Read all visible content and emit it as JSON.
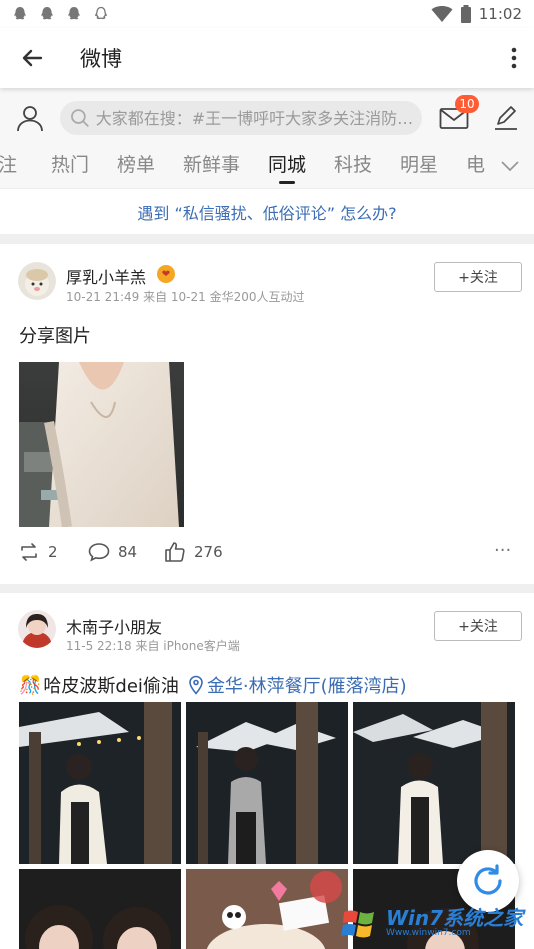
{
  "status_bar": {
    "time": "11:02",
    "icons": [
      "qq-icon",
      "qq-icon",
      "qq-icon",
      "qq-outline-icon",
      "wifi-icon",
      "battery-icon"
    ]
  },
  "app_bar": {
    "title": "微博"
  },
  "search": {
    "placeholder": "大家都在搜：#王一博呼吁大家多关注消防…",
    "mail_badge": "10"
  },
  "tabs": [
    {
      "label": "注"
    },
    {
      "label": "热门"
    },
    {
      "label": "榜单"
    },
    {
      "label": "新鲜事"
    },
    {
      "label": "同城",
      "active": true
    },
    {
      "label": "科技"
    },
    {
      "label": "明星"
    },
    {
      "label": "电"
    }
  ],
  "notice": "遇到 “私信骚扰、低俗评论” 怎么办?",
  "posts": [
    {
      "username": "厚乳小羊羔",
      "meta": "10-21 21:49 来自 10-21 金华200人互动过",
      "follow_label": "+关注",
      "text": "分享图片",
      "reposts": "2",
      "comments": "84",
      "likes": "276"
    },
    {
      "username": "木南子小朋友",
      "meta": "11-5 22:18 来自 iPhone客户端",
      "follow_label": "+关注",
      "text": "哈皮波斯dei偷油",
      "location": "金华·林萍餐厅(雁落湾店)"
    }
  ],
  "watermark": {
    "text": "Win7系统之家",
    "url": "Www.winwin7.com"
  },
  "colors": {
    "accent": "#3a6db5",
    "badge": "#ff5c33",
    "fab_icon": "#2f8be6"
  }
}
